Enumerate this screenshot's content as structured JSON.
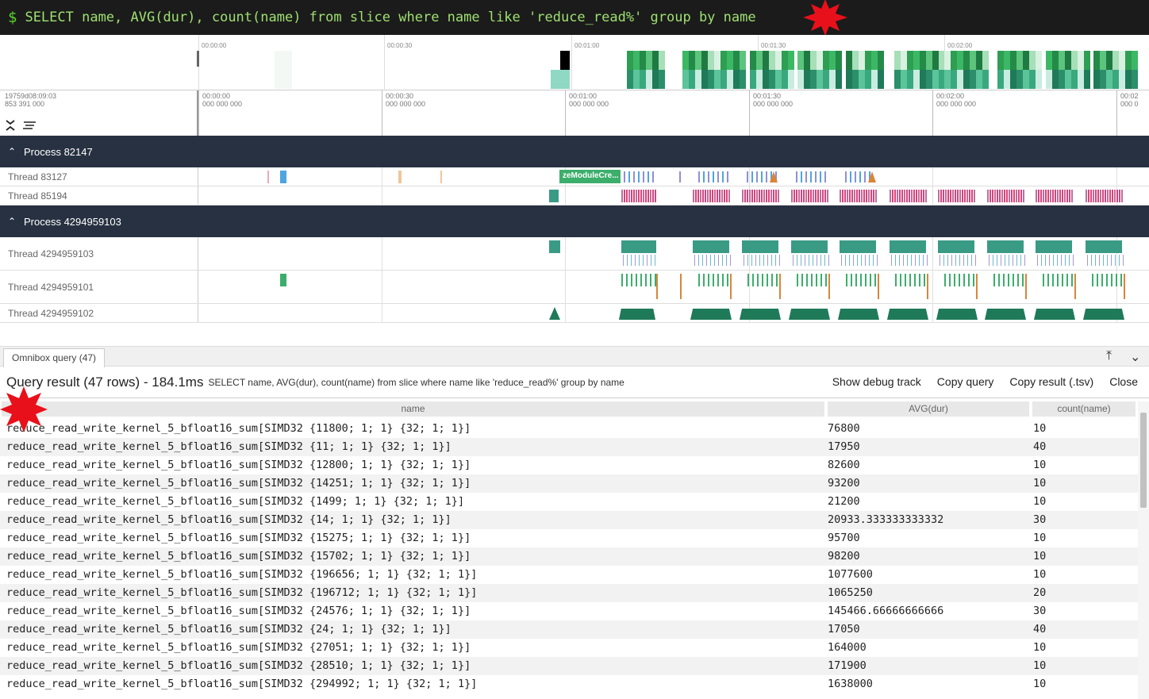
{
  "omnibox": {
    "prompt": "$",
    "query": "SELECT name, AVG(dur), count(name) from slice where name like 'reduce_read%' group by name"
  },
  "overview": {
    "tick_labels": [
      "00:00:00",
      "00:00:30",
      "00:01:00",
      "00:01:30",
      "00:02:00"
    ]
  },
  "ruler": {
    "origin_line1": "19759d08:09:03",
    "origin_line2": "853 391 000",
    "ticks": [
      {
        "t": "00:00:00",
        "ns": "000 000 000"
      },
      {
        "t": "00:00:30",
        "ns": "000 000 000"
      },
      {
        "t": "00:01:00",
        "ns": "000 000 000"
      },
      {
        "t": "00:01:30",
        "ns": "000 000 000"
      },
      {
        "t": "00:02:00",
        "ns": "000 000 000"
      },
      {
        "t": "00:02",
        "ns": "000 0"
      }
    ]
  },
  "processes": [
    {
      "label": "Process 82147",
      "threads": [
        "Thread 83127",
        "Thread 85194"
      ]
    },
    {
      "label": "Process 4294959103",
      "threads": [
        "Thread 4294959103",
        "Thread 4294959101",
        "Thread 4294959102"
      ]
    }
  ],
  "slice_label": "zeModuleCre...",
  "panel": {
    "tab_label": "Omnibox query (47)",
    "title": "Query result (47 rows) - 184.1ms",
    "query": "SELECT name, AVG(dur), count(name) from slice where name like 'reduce_read%' group by name",
    "buttons": {
      "debug": "Show debug track",
      "copy_query": "Copy query",
      "copy_result": "Copy result (.tsv)",
      "close": "Close"
    }
  },
  "table": {
    "columns": [
      "name",
      "AVG(dur)",
      "count(name)"
    ],
    "rows": [
      [
        "reduce_read_write_kernel_5_bfloat16_sum[SIMD32 {11800; 1; 1} {32; 1; 1}]",
        "76800",
        "10"
      ],
      [
        "reduce_read_write_kernel_5_bfloat16_sum[SIMD32 {11; 1; 1} {32; 1; 1}]",
        "17950",
        "40"
      ],
      [
        "reduce_read_write_kernel_5_bfloat16_sum[SIMD32 {12800; 1; 1} {32; 1; 1}]",
        "82600",
        "10"
      ],
      [
        "reduce_read_write_kernel_5_bfloat16_sum[SIMD32 {14251; 1; 1} {32; 1; 1}]",
        "93200",
        "10"
      ],
      [
        "reduce_read_write_kernel_5_bfloat16_sum[SIMD32 {1499; 1; 1} {32; 1; 1}]",
        "21200",
        "10"
      ],
      [
        "reduce_read_write_kernel_5_bfloat16_sum[SIMD32 {14; 1; 1} {32; 1; 1}]",
        "20933.333333333332",
        "30"
      ],
      [
        "reduce_read_write_kernel_5_bfloat16_sum[SIMD32 {15275; 1; 1} {32; 1; 1}]",
        "95700",
        "10"
      ],
      [
        "reduce_read_write_kernel_5_bfloat16_sum[SIMD32 {15702; 1; 1} {32; 1; 1}]",
        "98200",
        "10"
      ],
      [
        "reduce_read_write_kernel_5_bfloat16_sum[SIMD32 {196656; 1; 1} {32; 1; 1}]",
        "1077600",
        "10"
      ],
      [
        "reduce_read_write_kernel_5_bfloat16_sum[SIMD32 {196712; 1; 1} {32; 1; 1}]",
        "1065250",
        "20"
      ],
      [
        "reduce_read_write_kernel_5_bfloat16_sum[SIMD32 {24576; 1; 1} {32; 1; 1}]",
        "145466.66666666666",
        "30"
      ],
      [
        "reduce_read_write_kernel_5_bfloat16_sum[SIMD32 {24; 1; 1} {32; 1; 1}]",
        "17050",
        "40"
      ],
      [
        "reduce_read_write_kernel_5_bfloat16_sum[SIMD32 {27051; 1; 1} {32; 1; 1}]",
        "164000",
        "10"
      ],
      [
        "reduce_read_write_kernel_5_bfloat16_sum[SIMD32 {28510; 1; 1} {32; 1; 1}]",
        "171900",
        "10"
      ],
      [
        "reduce_read_write_kernel_5_bfloat16_sum[SIMD32 {294992; 1; 1} {32; 1; 1}]",
        "1638000",
        "10"
      ]
    ]
  },
  "colors": {
    "omnibox_bg": "#1b1b1b",
    "process_header_bg": "#273141",
    "slice_green": "#3cae6b",
    "slice_pink": "#d9437a",
    "slice_teal": "#3a9b85",
    "marker_red": "#e8101a"
  }
}
